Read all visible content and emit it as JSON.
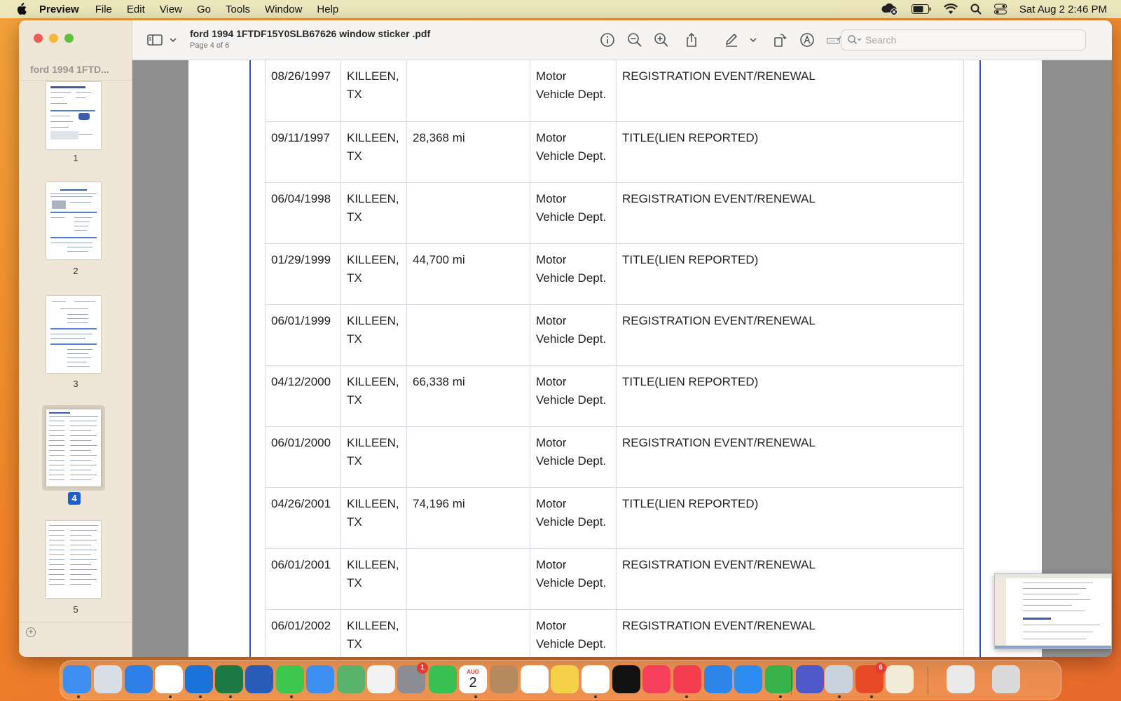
{
  "menubar": {
    "app_name": "Preview",
    "items": [
      "File",
      "Edit",
      "View",
      "Go",
      "Tools",
      "Window",
      "Help"
    ],
    "clock": "Sat Aug 2  2:46 PM"
  },
  "window": {
    "title": "ford 1994 1FTDF15Y0SLB67626 window sticker .pdf",
    "subtitle": "Page 4 of 6",
    "search_placeholder": "Search"
  },
  "sidebar": {
    "title": "ford 1994 1FTD...",
    "thumbnails": [
      {
        "label": "1"
      },
      {
        "label": "2"
      },
      {
        "label": "3"
      },
      {
        "label": "4",
        "selected": true
      },
      {
        "label": "5"
      }
    ]
  },
  "history_table": {
    "rows": [
      {
        "date": "08/26/1997",
        "location": [
          "KILLEEN,",
          "TX"
        ],
        "odometer": "",
        "source": [
          "Motor",
          "Vehicle Dept."
        ],
        "event": "REGISTRATION EVENT/RENEWAL"
      },
      {
        "date": "09/11/1997",
        "location": [
          "KILLEEN,",
          "TX"
        ],
        "odometer": "28,368 mi",
        "source": [
          "Motor",
          "Vehicle Dept."
        ],
        "event": "TITLE(LIEN REPORTED)"
      },
      {
        "date": "06/04/1998",
        "location": [
          "KILLEEN,",
          "TX"
        ],
        "odometer": "",
        "source": [
          "Motor",
          "Vehicle Dept."
        ],
        "event": "REGISTRATION EVENT/RENEWAL"
      },
      {
        "date": "01/29/1999",
        "location": [
          "KILLEEN,",
          "TX"
        ],
        "odometer": "44,700 mi",
        "source": [
          "Motor",
          "Vehicle Dept."
        ],
        "event": "TITLE(LIEN REPORTED)"
      },
      {
        "date": "06/01/1999",
        "location": [
          "KILLEEN,",
          "TX"
        ],
        "odometer": "",
        "source": [
          "Motor",
          "Vehicle Dept."
        ],
        "event": "REGISTRATION EVENT/RENEWAL"
      },
      {
        "date": "04/12/2000",
        "location": [
          "KILLEEN,",
          "TX"
        ],
        "odometer": "66,338 mi",
        "source": [
          "Motor",
          "Vehicle Dept."
        ],
        "event": "TITLE(LIEN REPORTED)"
      },
      {
        "date": "06/01/2000",
        "location": [
          "KILLEEN,",
          "TX"
        ],
        "odometer": "",
        "source": [
          "Motor",
          "Vehicle Dept."
        ],
        "event": "REGISTRATION EVENT/RENEWAL"
      },
      {
        "date": "04/26/2001",
        "location": [
          "KILLEEN,",
          "TX"
        ],
        "odometer": "74,196 mi",
        "source": [
          "Motor",
          "Vehicle Dept."
        ],
        "event": "TITLE(LIEN REPORTED)"
      },
      {
        "date": "06/01/2001",
        "location": [
          "KILLEEN,",
          "TX"
        ],
        "odometer": "",
        "source": [
          "Motor",
          "Vehicle Dept."
        ],
        "event": "REGISTRATION EVENT/RENEWAL"
      },
      {
        "date": "06/01/2002",
        "location": [
          "KILLEEN,",
          "TX"
        ],
        "odometer": "",
        "source": [
          "Motor",
          "Vehicle Dept."
        ],
        "event": "REGISTRATION EVENT/RENEWAL"
      }
    ]
  },
  "dock": {
    "calendar_month": "AUG",
    "calendar_day": "2",
    "badges": {
      "system_settings": "1",
      "microsoft_office": "6"
    },
    "icons": [
      {
        "name": "finder-icon",
        "color": "#3d8ef0"
      },
      {
        "name": "launchpad-icon",
        "color": "#d9dde6"
      },
      {
        "name": "safari-icon",
        "color": "#2f7fe8"
      },
      {
        "name": "chrome-icon",
        "color": "#ffffff"
      },
      {
        "name": "onedrive-icon",
        "color": "#1a73d9"
      },
      {
        "name": "excel-icon",
        "color": "#1d7a45"
      },
      {
        "name": "word-icon",
        "color": "#2a5cba"
      },
      {
        "name": "messages-icon",
        "color": "#3ec74f"
      },
      {
        "name": "mail-icon",
        "color": "#3c8ff0"
      },
      {
        "name": "maps-icon",
        "color": "#58b46a"
      },
      {
        "name": "photos-icon",
        "color": "#f2f2f2"
      },
      {
        "name": "system-settings-icon",
        "color": "#8b8d93"
      },
      {
        "name": "facetime-icon",
        "color": "#37c152"
      },
      {
        "name": "calendar-icon",
        "color": "#ffffff"
      },
      {
        "name": "contacts-icon",
        "color": "#b48a5e"
      },
      {
        "name": "reminders-icon",
        "color": "#ffffff"
      },
      {
        "name": "notes-icon",
        "color": "#f6d24b"
      },
      {
        "name": "freeform-icon",
        "color": "#ffffff"
      },
      {
        "name": "apple-tv-icon",
        "color": "#111111"
      },
      {
        "name": "music-icon",
        "color": "#f4405a"
      },
      {
        "name": "news-icon",
        "color": "#f43d4f"
      },
      {
        "name": "keynote-icon",
        "color": "#2f86ea"
      },
      {
        "name": "app-store-icon",
        "color": "#2d8cf0"
      },
      {
        "name": "numbers-icon",
        "color": "#37b14a"
      },
      {
        "name": "teams-icon",
        "color": "#5059c9"
      },
      {
        "name": "preview-icon",
        "color": "#c9d3de"
      },
      {
        "name": "microsoft-office-icon",
        "color": "#e84a27"
      },
      {
        "name": "textedit-icon",
        "color": "#f3ecd9"
      },
      {
        "name": "downloads-stack-icon",
        "color": "#e9e9e9"
      },
      {
        "name": "trash-icon",
        "color": "#dadada"
      }
    ]
  }
}
